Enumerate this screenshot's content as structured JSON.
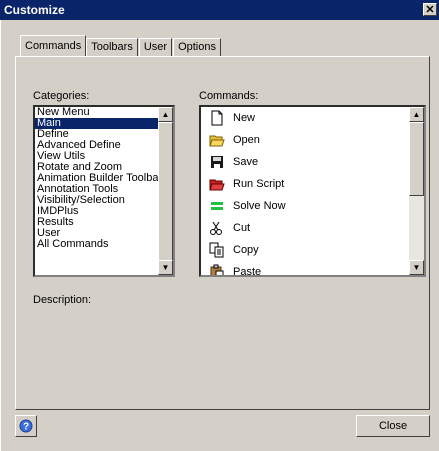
{
  "window": {
    "title": "Customize",
    "close_glyph": "✕"
  },
  "tabs": [
    {
      "label": "Commands"
    },
    {
      "label": "Toolbars"
    },
    {
      "label": "User"
    },
    {
      "label": "Options"
    }
  ],
  "categories": {
    "label": "Categories:",
    "items": [
      "New Menu",
      "Main",
      "Define",
      "Advanced Define",
      "View Utils",
      "Rotate and Zoom",
      "Animation Builder Toolbar",
      "Annotation Tools",
      "Visibility/Selection",
      "IMDPlus",
      "Results",
      "User",
      "All Commands"
    ],
    "selected": "Main"
  },
  "commands": {
    "label": "Commands:",
    "items": [
      {
        "label": "New",
        "icon": "new-document-icon"
      },
      {
        "label": "Open",
        "icon": "open-folder-icon"
      },
      {
        "label": "Save",
        "icon": "save-disk-icon"
      },
      {
        "label": "Run Script",
        "icon": "run-script-icon"
      },
      {
        "label": "Solve Now",
        "icon": "solve-now-icon"
      },
      {
        "label": "Cut",
        "icon": "scissors-icon"
      },
      {
        "label": "Copy",
        "icon": "copy-icon"
      },
      {
        "label": "Paste",
        "icon": "paste-icon"
      }
    ]
  },
  "description": {
    "label": "Description:"
  },
  "footer": {
    "help_icon": "help-icon",
    "close_label": "Close"
  },
  "colors": {
    "titlebar": "#0a246a",
    "face": "#d4d0c8",
    "selection": "#0a246a"
  }
}
